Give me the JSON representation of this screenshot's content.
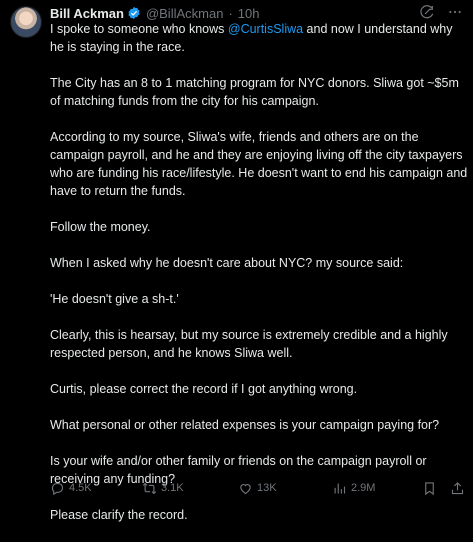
{
  "header": {
    "name": "Bill Ackman",
    "handle": "@BillAckman",
    "separator": "·",
    "time": "10h"
  },
  "tweet": {
    "p1_before": "I spoke to someone who knows ",
    "p1_mention": "@CurtisSliwa",
    "p1_after": " and now I understand why he is staying in the race.",
    "p2": "The City has an 8 to 1 matching program for NYC donors.  Sliwa got ~$5m of matching funds from the city for his campaign.",
    "p3": "According to my source, Sliwa's wife, friends and others are on the campaign payroll, and he and they are enjoying living off the city taxpayers who are funding his race/lifestyle. He doesn't want to end his campaign and have to return the funds.",
    "p4": "Follow the money.",
    "p5": "When I asked why he doesn't care about NYC? my source said:",
    "p6": "'He doesn't give a sh-t.'",
    "p7": "Clearly, this is hearsay, but my source is extremely credible and a highly respected person, and he knows Sliwa well.",
    "p8": "Curtis, please correct the record if I got anything wrong.",
    "p9": "What personal or other related expenses is your campaign paying for?",
    "p10": "Is your wife and/or other family or friends on the campaign payroll or receiving any funding?",
    "p11": "Please clarify the record."
  },
  "actions": {
    "replies": "4.5K",
    "reposts": "3.1K",
    "likes": "13K",
    "views": "2.9M"
  },
  "icons": {
    "verified": "verified-badge-icon",
    "grok": "grok-icon",
    "more": "more-icon",
    "reply": "reply-icon",
    "repost": "repost-icon",
    "like": "heart-icon",
    "views": "views-icon",
    "bookmark": "bookmark-icon",
    "share": "share-icon"
  },
  "colors": {
    "background": "#000000",
    "text": "#e7e9ea",
    "muted": "#71767b",
    "accent": "#1d9bf0"
  }
}
